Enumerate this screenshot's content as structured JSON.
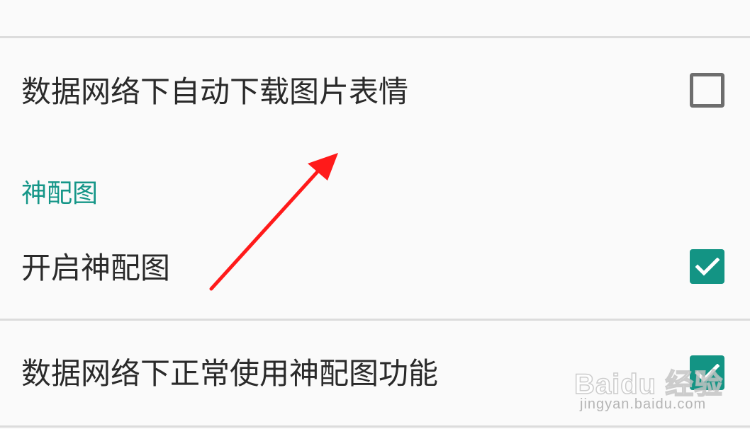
{
  "settings": {
    "top_item_fragment": "",
    "rows": [
      {
        "label": "数据网络下自动下载图片表情",
        "checked": false
      },
      {
        "label": "开启神配图",
        "checked": true
      },
      {
        "label": "数据网络下正常使用神配图功能",
        "checked": true
      }
    ],
    "section_header": "神配图"
  },
  "watermark": {
    "brand": "Baidu 经验",
    "url": "jingyan.baidu.com"
  },
  "colors": {
    "accent": "#159688",
    "checkbox_checked": "#139484",
    "checkbox_unchecked_border": "#6d6d6d",
    "annotation_arrow": "#ff1a1a",
    "divider": "#dcdcdc",
    "background": "#fafafa"
  }
}
